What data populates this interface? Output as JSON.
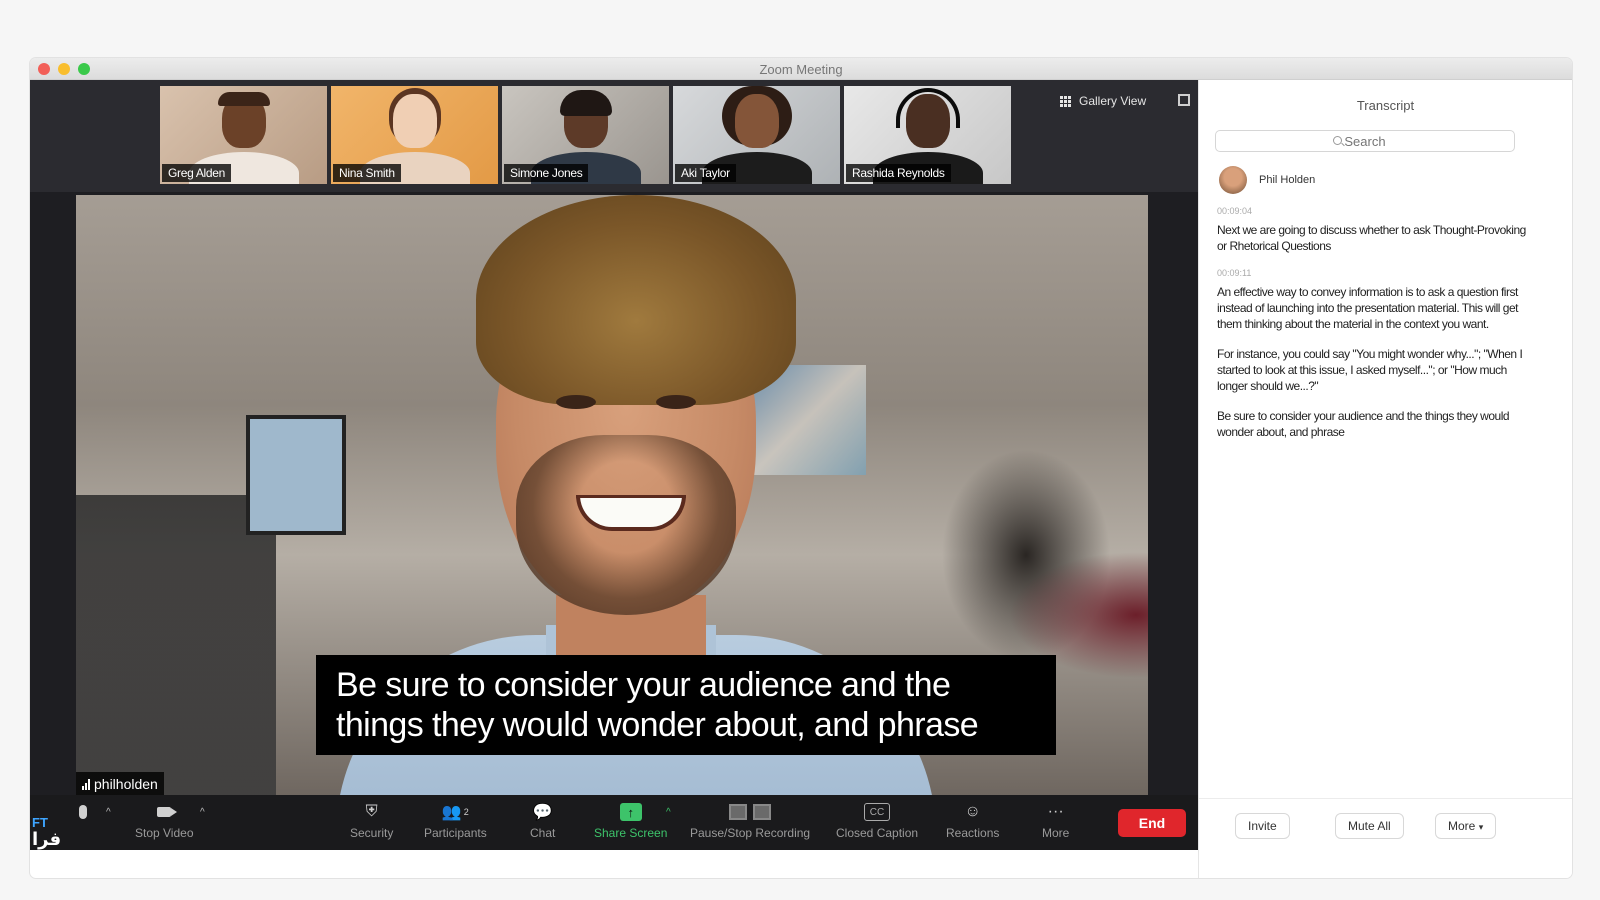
{
  "window": {
    "title": "Zoom Meeting"
  },
  "gallery": {
    "participants": [
      {
        "name": "Greg Alden"
      },
      {
        "name": "Nina Smith"
      },
      {
        "name": "Simone Jones"
      },
      {
        "name": "Aki Taylor"
      },
      {
        "name": "Rashida Reynolds"
      }
    ],
    "view_label": "Gallery View"
  },
  "speaker": {
    "name": "philholden",
    "caption_line1": "Be sure to consider your audience and the",
    "caption_line2": "things they would wonder about, and phrase"
  },
  "toolbar": {
    "stop_video": "Stop Video",
    "security": "Security",
    "participants": "Participants",
    "participants_count": "2",
    "chat": "Chat",
    "share_screen": "Share Screen",
    "recording": "Pause/Stop Recording",
    "closed_caption": "Closed Caption",
    "reactions": "Reactions",
    "more": "More",
    "end": "End",
    "share_color": "#3dc36a",
    "end_color": "#e0262c"
  },
  "transcript": {
    "title": "Transcript",
    "search_placeholder": "Search",
    "speaker_name": "Phil Holden",
    "entries": [
      {
        "time": "00:09:04",
        "text": "Next we are going to discuss whether to ask Thought-Provoking or Rhetorical Questions"
      },
      {
        "time": "00:09:11",
        "text": "An effective way to convey information is to ask a question first instead of launching into the presentation material. This will get them thinking about the material in the context you want."
      },
      {
        "time": "",
        "text": "For instance, you could say \"You might wonder why...\"; \"When I started to look at this issue, I asked myself...\"; or \"How much longer should we...?\""
      },
      {
        "time": "",
        "text": "Be sure to consider your audience and the things they would wonder about, and phrase"
      }
    ],
    "invite": "Invite",
    "mute_all": "Mute All",
    "more": "More"
  },
  "watermark": {
    "line1": "FT",
    "line2": "فرا"
  }
}
